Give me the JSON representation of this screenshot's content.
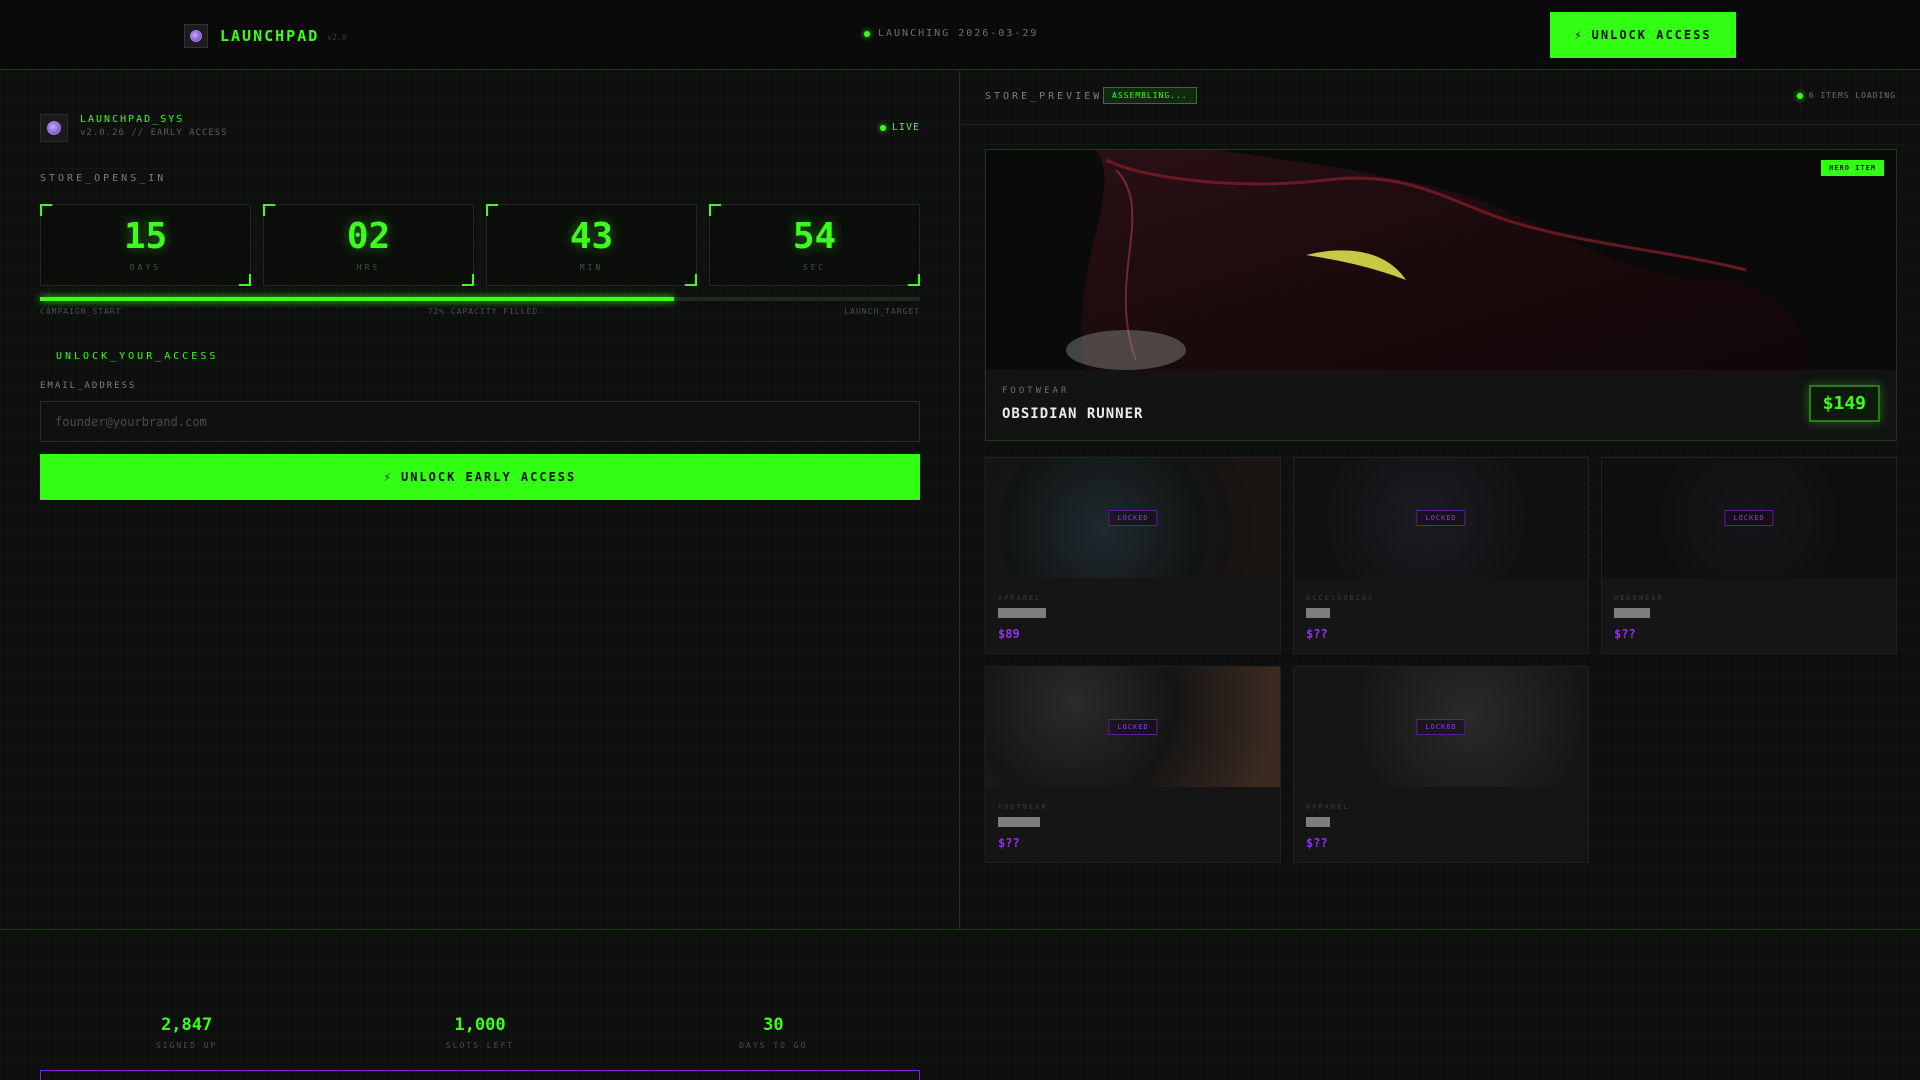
{
  "header": {
    "brand": "LAUNCHPAD",
    "version": "v2.0",
    "launch_status": "LAUNCHING 2026-03-29",
    "cta_icon": "⚡",
    "cta_label": "UNLOCK ACCESS"
  },
  "left": {
    "sys_name": "LAUNCHPAD_SYS",
    "sys_sub": "v2.0.26 // EARLY ACCESS",
    "live_label": "LIVE",
    "countdown_label": "STORE_OPENS_IN",
    "countdown": [
      {
        "value": "15",
        "unit": "DAYS"
      },
      {
        "value": "02",
        "unit": "HRS"
      },
      {
        "value": "43",
        "unit": "MIN"
      },
      {
        "value": "54",
        "unit": "SEC"
      }
    ],
    "progress": {
      "fraction": 0.72,
      "start_label": "CAMPAIGN_START",
      "mid_label": "72% CAPACITY FILLED",
      "end_label": "LAUNCH_TARGET"
    },
    "unlock_title": "UNLOCK_YOUR_ACCESS",
    "email_label": "EMAIL_ADDRESS",
    "email_placeholder": "founder@yourbrand.com",
    "email_value": "",
    "cta_icon": "⚡",
    "cta_label": "UNLOCK EARLY ACCESS"
  },
  "stats": [
    {
      "value": "2,847",
      "label": "SIGNED UP"
    },
    {
      "value": "1,000",
      "label": "SLOTS LEFT"
    },
    {
      "value": "30",
      "label": "DAYS TO GO"
    }
  ],
  "store": {
    "title": "STORE_PREVIEW",
    "status_badge": "ASSEMBLING...",
    "items_loading": "6 ITEMS LOADING",
    "hero": {
      "badge": "HERO ITEM",
      "category": "FOOTWEAR",
      "name": "OBSIDIAN RUNNER",
      "price": "$149"
    },
    "locked_label": "LOCKED",
    "products": [
      {
        "category": "APPAREL",
        "price": "$89"
      },
      {
        "category": "ACCESSORIES",
        "price": "$??"
      },
      {
        "category": "HEADWEAR",
        "price": "$??"
      },
      {
        "category": "FOOTWEAR",
        "price": "$??"
      },
      {
        "category": "APPAREL",
        "price": "$??"
      }
    ]
  },
  "colors": {
    "accent": "#33ff14",
    "locked": "#8e3fe0",
    "price_locked": "#9333ea"
  }
}
